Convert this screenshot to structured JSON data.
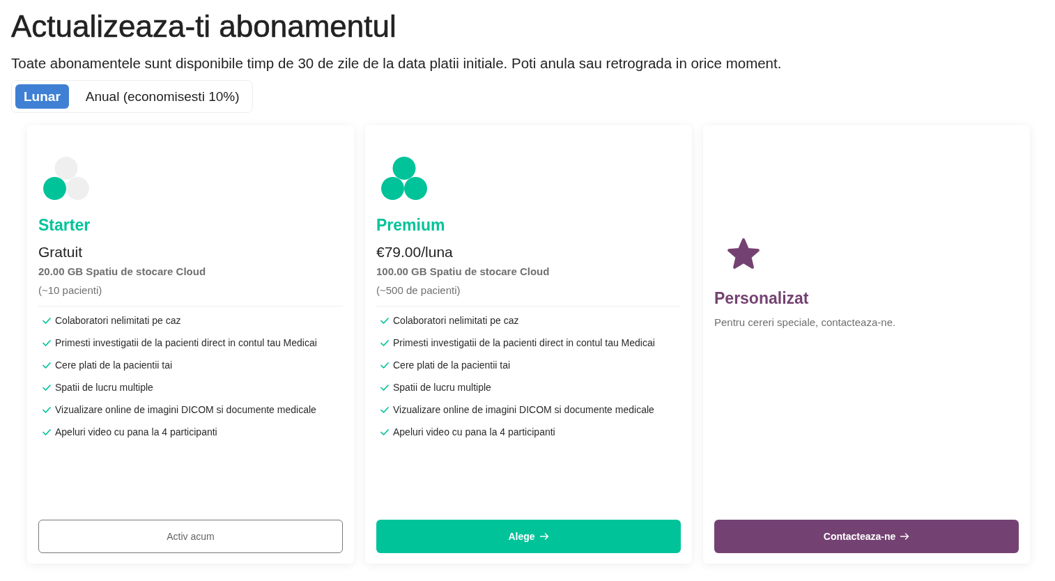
{
  "page": {
    "title": "Actualizeaza-ti abonamentul",
    "subtitle": "Toate abonamentele sunt disponibile timp de 30 de zile de la data platii initiale. Poti anula sau retrograda in orice moment."
  },
  "billing": {
    "options": [
      {
        "label": "Lunar",
        "selected": true
      },
      {
        "label": "Anual (economisesti 10%)",
        "selected": false
      }
    ]
  },
  "plans": [
    {
      "kind": "starter",
      "name": "Starter",
      "price": "Gratuit",
      "storage": "20.00 GB Spatiu de stocare Cloud",
      "patients": "(~10 pacienti)",
      "features": [
        "Colaboratori nelimitati pe caz",
        "Primesti investigatii de la pacienti direct in contul tau Medicai",
        "Cere plati de la pacientii tai",
        "Spatii de lucru multiple",
        "Vizualizare online de imagini DICOM si documente medicale",
        "Apeluri video cu pana la 4 participanti"
      ],
      "button": "Activ acum"
    },
    {
      "kind": "premium",
      "name": "Premium",
      "price": "€79.00/luna",
      "storage": "100.00 GB Spatiu de stocare Cloud",
      "patients": "(~500 de pacienti)",
      "features": [
        "Colaboratori nelimitati pe caz",
        "Primesti investigatii de la pacienti direct in contul tau Medicai",
        "Cere plati de la pacientii tai",
        "Spatii de lucru multiple",
        "Vizualizare online de imagini DICOM si documente medicale",
        "Apeluri video cu pana la 4 participanti"
      ],
      "button": "Alege"
    },
    {
      "kind": "custom",
      "name": "Personalizat",
      "description": "Pentru cereri speciale, contacteaza-ne.",
      "button": "Contacteaza-ne"
    }
  ]
}
